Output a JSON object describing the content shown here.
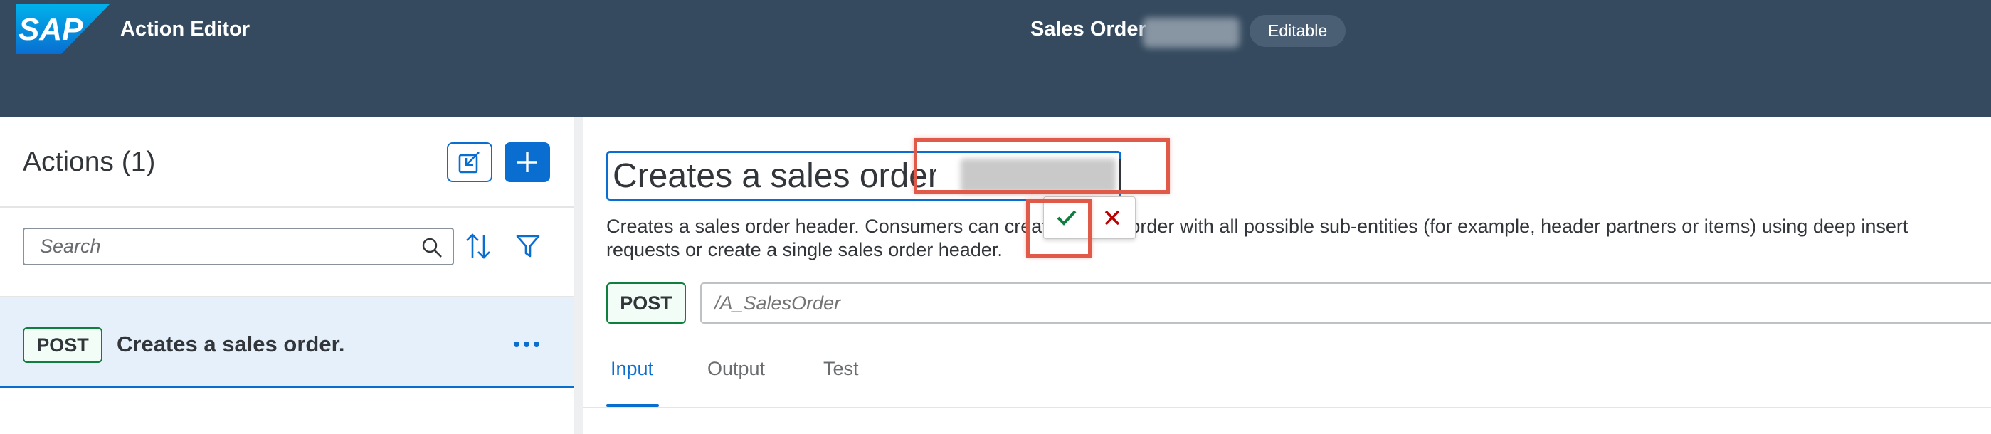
{
  "shell": {
    "logo_text": "SAP",
    "app_title": "Action Editor",
    "object_title": "Sales Order",
    "status_badge": "Editable",
    "colors": {
      "shell_bg": "#354a5f",
      "logo_blue": "#0a6ed1"
    }
  },
  "master": {
    "title": "Actions (1)",
    "export_icon": "export-icon",
    "add_icon": "plus-icon",
    "search": {
      "placeholder": "Search",
      "value": "",
      "icon": "search-icon"
    },
    "sort_icon": "sort-icon",
    "filter_icon": "filter-icon",
    "items": [
      {
        "method": "POST",
        "label": "Creates a sales order.",
        "more_icon": "more-icon",
        "selected": true
      }
    ]
  },
  "detail": {
    "title_value": "Creates a sales order",
    "description": "Creates a sales order header. Consumers can create a sales order with all possible sub-entities (for example, header partners or items) using deep insert requests or create a single sales order header.",
    "method": "POST",
    "path_value": "",
    "path_placeholder": "/A_SalesOrder",
    "confirm_icon": "checkmark-icon",
    "cancel_icon": "close-icon",
    "tabs": [
      {
        "label": "Input",
        "active": true
      },
      {
        "label": "Output",
        "active": false
      },
      {
        "label": "Test",
        "active": false
      }
    ],
    "colors": {
      "accent": "#0a6ed1",
      "post_green": "#107e3e",
      "confirm_green": "#107e3e",
      "cancel_red": "#bb0000",
      "annotation_red": "#e05a4a"
    }
  }
}
